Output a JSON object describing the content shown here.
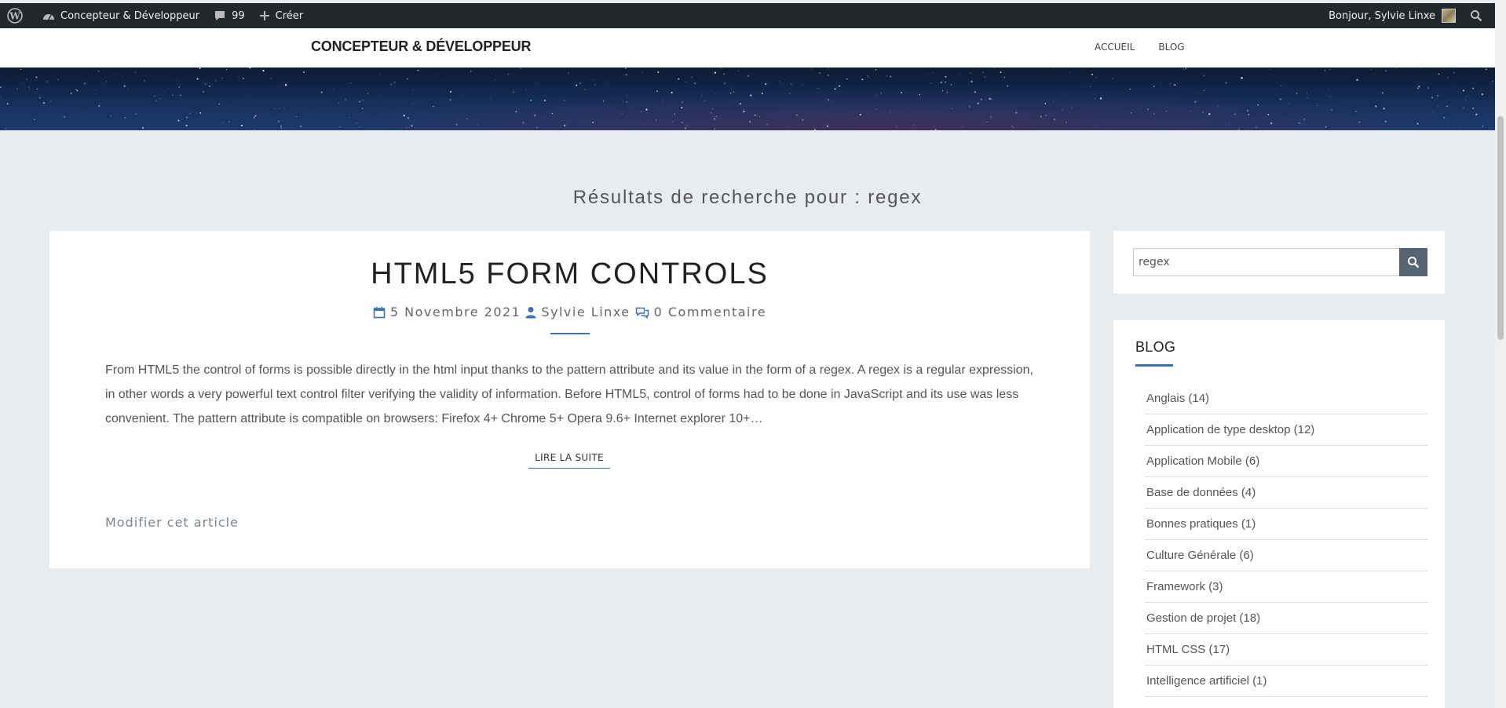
{
  "adminbar": {
    "site_name": "Concepteur & Développeur",
    "comments_count": "99",
    "create_label": "Créer",
    "greeting": "Bonjour, Sylvie Linxe"
  },
  "header": {
    "brand": "CONCEPTEUR & DÉVELOPPEUR",
    "nav": [
      "ACCUEIL",
      "BLOG"
    ]
  },
  "search_heading": "Résultats de recherche pour : regex",
  "post": {
    "title": "HTML5 FORM CONTROLS",
    "date": "5 Novembre 2021",
    "author": "Sylvie Linxe",
    "comments": "0 Commentaire",
    "excerpt": "From HTML5 the control of forms is possible directly in the html input thanks to the pattern attribute and its value in the form of a regex. A regex is a regular expression, in other words a very powerful text control filter verifying the validity of information. Before HTML5, control of forms had to be done in JavaScript and its use was less convenient. The pattern attribute is compatible on browsers: Firefox 4+ Chrome 5+ Opera 9.6+ Internet explorer 10+…",
    "read_more": "LIRE LA SUITE",
    "edit_link": "Modifier cet article"
  },
  "sidebar": {
    "search_value": "regex",
    "blog_title": "BLOG",
    "categories": [
      "Anglais (14)",
      "Application de type desktop (12)",
      "Application Mobile (6)",
      "Base de données (4)",
      "Bonnes pratiques (1)",
      "Culture Générale (6)",
      "Framework (3)",
      "Gestion de projet (18)",
      "HTML CSS (17)",
      "Intelligence artificiel (1)"
    ]
  },
  "colors": {
    "accent": "#3a73b4",
    "adminbar": "#23282d",
    "page_bg": "#e9ecef",
    "search_button": "#566573"
  }
}
